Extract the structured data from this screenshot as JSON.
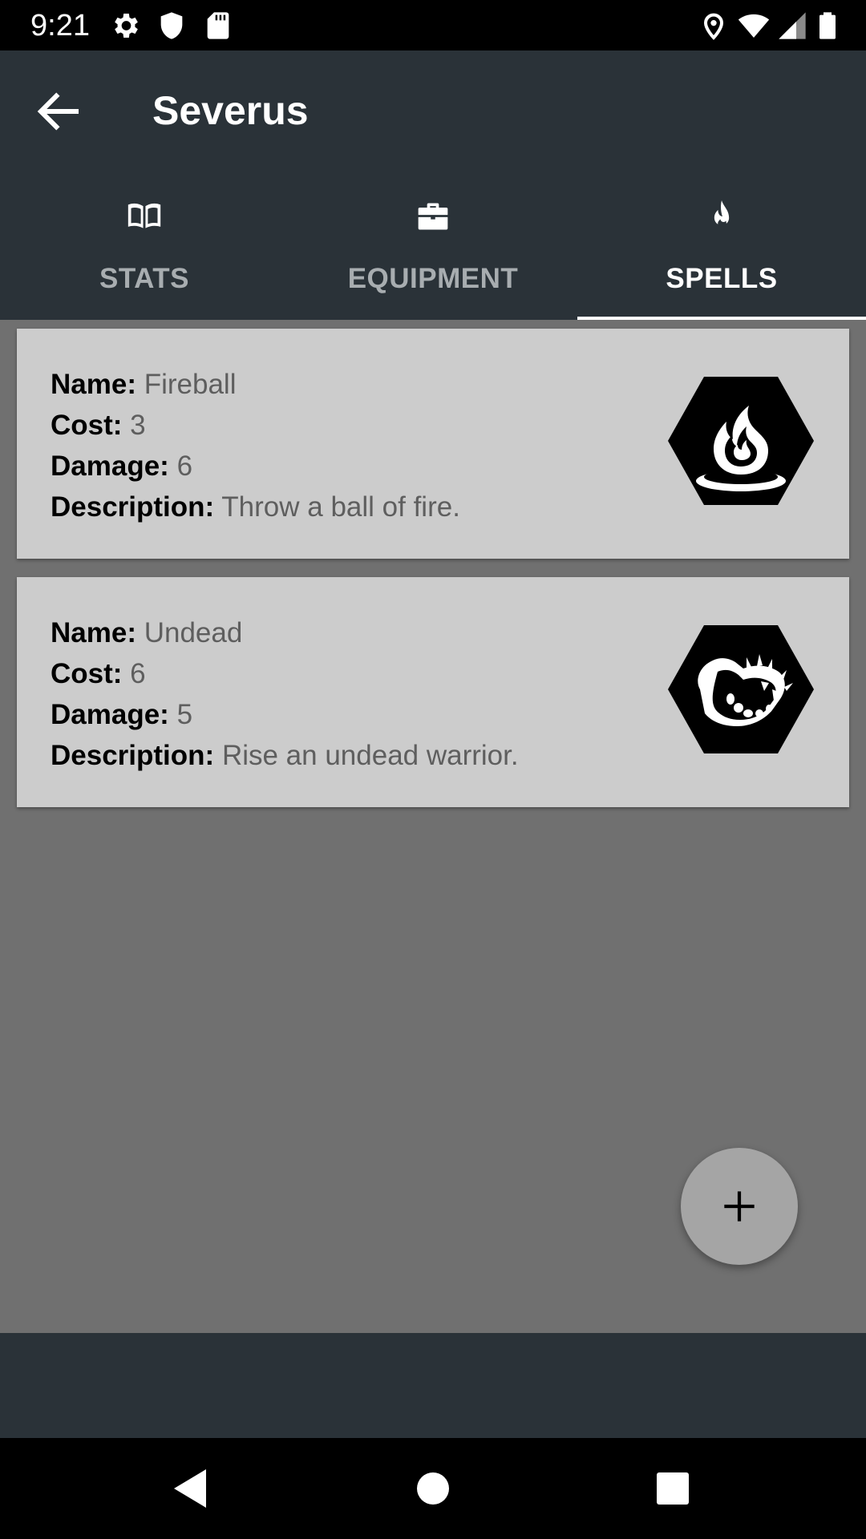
{
  "status_bar": {
    "time": "9:21",
    "left_icons": [
      "gear-icon",
      "shield-icon",
      "sd-card-icon"
    ],
    "right_icons": [
      "location-icon",
      "wifi-icon",
      "signal-icon",
      "battery-icon"
    ]
  },
  "app_bar": {
    "title": "Severus",
    "back_icon": "arrow-back-icon"
  },
  "tabs": [
    {
      "label": "STATS",
      "icon": "book-icon",
      "active": false
    },
    {
      "label": "EQUIPMENT",
      "icon": "briefcase-icon",
      "active": false
    },
    {
      "label": "SPELLS",
      "icon": "flame-icon",
      "active": true
    }
  ],
  "spells": [
    {
      "name_label": "Name:",
      "name": "Fireball",
      "cost_label": "Cost:",
      "cost": "3",
      "damage_label": "Damage:",
      "damage": "6",
      "description_label": "Description:",
      "description": "Throw a ball of fire.",
      "icon": "fire-hexagon-icon"
    },
    {
      "name_label": "Name:",
      "name": "Undead",
      "cost_label": "Cost:",
      "cost": "6",
      "damage_label": "Damage:",
      "damage": "5",
      "description_label": "Description:",
      "description": "Rise an undead warrior.",
      "icon": "jaw-hexagon-icon"
    }
  ],
  "fab": {
    "icon": "plus-icon"
  },
  "nav_bar": {
    "icons": [
      "back-triangle-icon",
      "home-circle-icon",
      "recents-square-icon"
    ]
  },
  "colors": {
    "app_bar": "#2a3238",
    "content_bg": "#707070",
    "card_bg": "#cccccc",
    "tab_inactive": "#a8adb0",
    "tab_active": "#ffffff",
    "fab_bg": "#a5a5a5"
  }
}
